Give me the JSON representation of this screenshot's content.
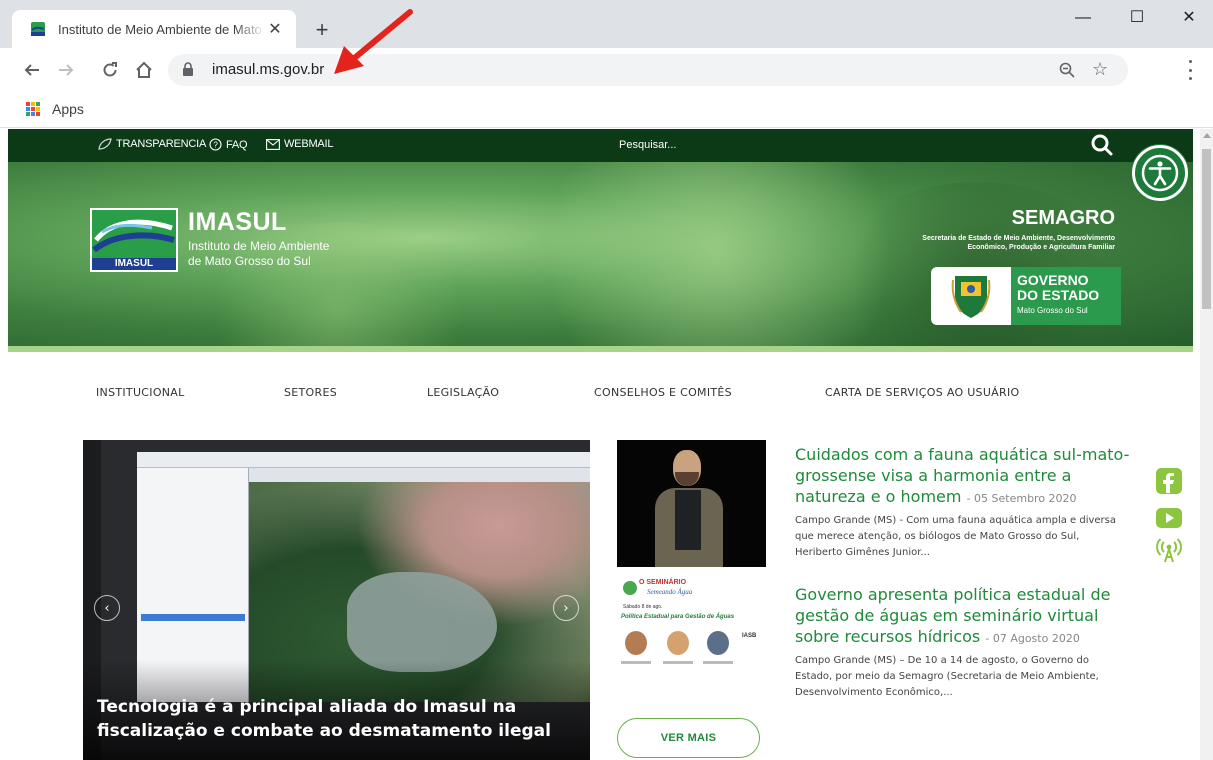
{
  "browser": {
    "tab": {
      "title": "Instituto de Meio Ambiente de Mato Grosso do Sul",
      "close": "✕"
    },
    "new_tab": "+",
    "window": {
      "minimize": "—",
      "maximize": "☐",
      "close": "✕"
    },
    "address": {
      "url": "imasul.ms.gov.br"
    },
    "bookmarks": {
      "apps_label": "Apps"
    },
    "colors": {
      "accent_arrow": "#e3241c",
      "apps_grid": [
        "#ea4335",
        "#fbbc05",
        "#34a853",
        "#4285f4",
        "#ea4335",
        "#fbbc05",
        "#34a853",
        "#4285f4",
        "#ea4335"
      ]
    }
  },
  "site": {
    "topbar": {
      "links": [
        "TRANSPARENCIA",
        "FAQ",
        "WEBMAIL"
      ],
      "search_placeholder": "Pesquisar..."
    },
    "header": {
      "logo_word": "IMASUL",
      "title": "IMASUL",
      "subtitle_line1": "Instituto de Meio Ambiente",
      "subtitle_line2": "de Mato Grosso do Sul",
      "semagro_title": "SEMAGRO",
      "semagro_sub": "Secretaria de Estado de Meio Ambiente, Desenvolvimento Econômico, Produção e Agricultura Familiar",
      "gov_line1": "GOVERNO",
      "gov_line2": "DO ESTADO",
      "gov_line3": "Mato Grosso do Sul"
    },
    "nav": [
      "INSTITUCIONAL",
      "SETORES",
      "LEGISLAÇÃO",
      "CONSELHOS E COMITÊS",
      "CARTA DE SERVIÇOS AO USUÁRIO"
    ],
    "slider": {
      "caption": "Tecnologia é a principal aliada do Imasul na fiscalização e combate ao desmatamento ilegal",
      "prev": "‹",
      "next": "›"
    },
    "thumb2": {
      "t1": "O SEMINÁRIO",
      "t2": "Semeando Água",
      "t3": "Sábado 8 de ago.",
      "t4": "Política Estadual para Gestão de Águas",
      "iasb": "IASB"
    },
    "news": [
      {
        "title": "Cuidados com a fauna aquática sul-mato-grossense visa a harmonia entre a natureza e o homem",
        "date": "- 05 Setembro 2020",
        "body": "Campo Grande (MS) - Com uma fauna aquática ampla e diversa que merece atenção, os biólogos de Mato Grosso do Sul, Heriberto Gimênes Junior..."
      },
      {
        "title": "Governo apresenta política estadual de gestão de águas em seminário virtual sobre recursos hídricos",
        "date": "- 07 Agosto 2020",
        "body": "Campo Grande (MS) – De 10 a 14 de agosto, o Governo do Estado, por meio da Semagro (Secretaria de Meio Ambiente, Desenvolvimento Econômico,..."
      }
    ],
    "ver_mais": "VER MAIS"
  }
}
